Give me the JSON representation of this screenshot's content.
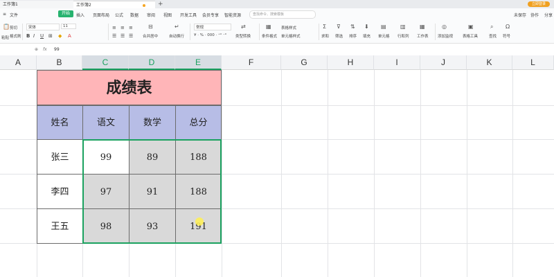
{
  "tabs": [
    {
      "label": "工作簿1"
    },
    {
      "label": "工作簿2"
    }
  ],
  "new_tab": "+",
  "login_label": "立即登录",
  "menu": {
    "hamburger": "≡",
    "file": "文件",
    "start": "开始",
    "items": [
      "插入",
      "页面布局",
      "公式",
      "数据",
      "审阅",
      "视图",
      "开发工具",
      "会员专享",
      "智能资源"
    ],
    "search_placeholder": "查找命令、搜索模板",
    "right": [
      "未保存",
      "协作",
      "分享"
    ]
  },
  "ribbon": {
    "paste": "粘贴",
    "cut": "剪切",
    "copy": "复制",
    "format_painter": "格式刷",
    "font_name": "宋体",
    "font_size": "11",
    "merge_center": "合并居中",
    "wrap_text": "自动换行",
    "number_format": "常规",
    "type_convert": "类型转换",
    "conditional_format": "条件格式",
    "table_style": "表格样式",
    "cell_style": "单元格样式",
    "sum": "求和",
    "filter": "筛选",
    "sort": "排序",
    "fill": "填充",
    "cells": "单元格",
    "rows_cols": "行和列",
    "worksheet": "工作表",
    "add_watch": "添加监视",
    "table_tools": "表格工具",
    "find": "查找",
    "symbol": "符号"
  },
  "formula_bar": {
    "fx": "fx",
    "content": "99"
  },
  "columns": [
    "A",
    "B",
    "C",
    "D",
    "E",
    "F",
    "G",
    "H",
    "I",
    "J",
    "K",
    "L"
  ],
  "table": {
    "title": "成绩表",
    "headers": [
      "姓名",
      "语文",
      "数学",
      "总分"
    ],
    "rows": [
      {
        "name": "张三",
        "chinese": "99",
        "math": "89",
        "total": "188"
      },
      {
        "name": "李四",
        "chinese": "97",
        "math": "91",
        "total": "188"
      },
      {
        "name": "王五",
        "chinese": "98",
        "math": "93",
        "total": "191"
      }
    ]
  },
  "colors": {
    "title_fill": "#ffb5b8",
    "header_fill": "#b7bde6",
    "selected_fill": "#d9d9d9",
    "accent": "#1aa15f"
  }
}
